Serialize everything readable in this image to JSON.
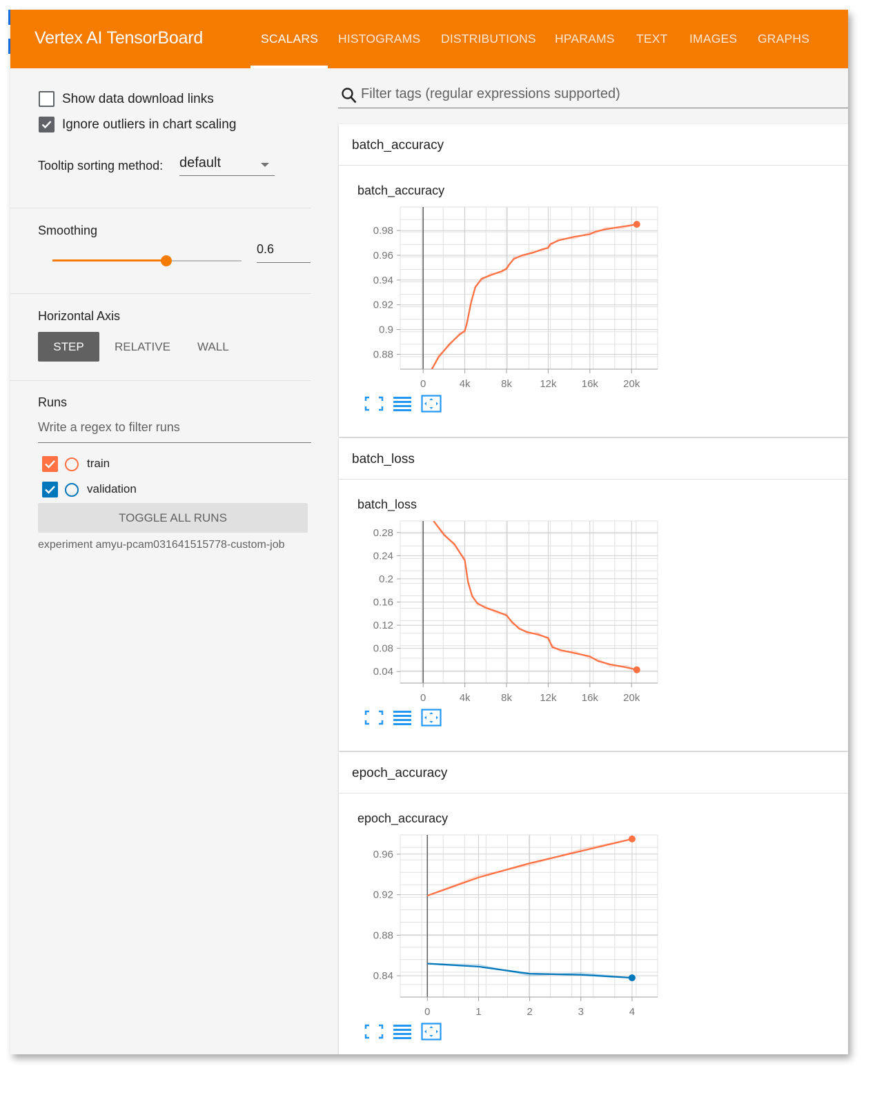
{
  "app": {
    "title": "Vertex AI TensorBoard"
  },
  "tabs": [
    {
      "label": "SCALARS",
      "active": true
    },
    {
      "label": "HISTOGRAMS",
      "active": false
    },
    {
      "label": "DISTRIBUTIONS",
      "active": false
    },
    {
      "label": "HPARAMS",
      "active": false
    },
    {
      "label": "TEXT",
      "active": false
    },
    {
      "label": "IMAGES",
      "active": false
    },
    {
      "label": "GRAPHS",
      "active": false
    }
  ],
  "sidebar": {
    "show_download_links": {
      "label": "Show data download links",
      "checked": false
    },
    "ignore_outliers": {
      "label": "Ignore outliers in chart scaling",
      "checked": true
    },
    "tooltip_sorting": {
      "label": "Tooltip sorting method:",
      "value": "default"
    },
    "smoothing": {
      "label": "Smoothing",
      "value": "0.6",
      "level": 0.6
    },
    "horizontal_axis": {
      "label": "Horizontal Axis",
      "options": [
        "STEP",
        "RELATIVE",
        "WALL"
      ],
      "selected": "STEP"
    },
    "runs": {
      "label": "Runs",
      "filter_placeholder": "Write a regex to filter runs",
      "items": [
        {
          "name": "train",
          "color": "#ff7043",
          "checked": true
        },
        {
          "name": "validation",
          "color": "#0077bb",
          "checked": true
        }
      ],
      "toggle_all_label": "TOGGLE ALL RUNS",
      "experiment": "experiment amyu-pcam031641515778-custom-job"
    }
  },
  "search": {
    "placeholder": "Filter tags (regular expressions supported)"
  },
  "colors": {
    "header": "#f57c00",
    "train": "#ff7043",
    "validation": "#0077bb",
    "icon": "#2196f3"
  },
  "icons": [
    "search-icon",
    "fit-domain-icon",
    "toggle-log-icon",
    "fullscreen-icon"
  ],
  "cards": [
    {
      "title": "batch_accuracy",
      "chart_title": "batch_accuracy"
    },
    {
      "title": "batch_loss",
      "chart_title": "batch_loss"
    },
    {
      "title": "epoch_accuracy",
      "chart_title": "epoch_accuracy"
    }
  ],
  "chart_data": [
    {
      "type": "line",
      "title": "batch_accuracy",
      "x_ticks": [
        "0",
        "4k",
        "8k",
        "12k",
        "16k",
        "20k"
      ],
      "y_ticks": [
        "0.88",
        "0.9",
        "0.92",
        "0.94",
        "0.96",
        "0.98"
      ],
      "xlim": [
        -2200,
        22500
      ],
      "ylim": [
        0.868,
        0.999
      ],
      "grid": true,
      "series": [
        {
          "name": "train",
          "color": "#ff7043",
          "x": [
            700,
            1500,
            2500,
            3500,
            4000,
            4200,
            4600,
            5000,
            5600,
            6500,
            7500,
            8000,
            8200,
            8700,
            9500,
            10500,
            11500,
            12000,
            12200,
            13000,
            14500,
            16000,
            16500,
            17500,
            19000,
            20500
          ],
          "y": [
            0.866,
            0.878,
            0.888,
            0.896,
            0.899,
            0.905,
            0.922,
            0.934,
            0.941,
            0.944,
            0.947,
            0.949,
            0.952,
            0.957,
            0.96,
            0.962,
            0.965,
            0.966,
            0.969,
            0.972,
            0.975,
            0.977,
            0.979,
            0.981,
            0.983,
            0.985
          ]
        }
      ]
    },
    {
      "type": "line",
      "title": "batch_loss",
      "x_ticks": [
        "0",
        "4k",
        "8k",
        "12k",
        "16k",
        "20k"
      ],
      "y_ticks": [
        "0.04",
        "0.08",
        "0.12",
        "0.16",
        "0.2",
        "0.24",
        "0.28"
      ],
      "xlim": [
        -2200,
        22500
      ],
      "ylim": [
        0.02,
        0.3
      ],
      "grid": true,
      "series": [
        {
          "name": "train",
          "color": "#ff7043",
          "x": [
            1000,
            2000,
            3000,
            4000,
            4300,
            4700,
            5200,
            6000,
            7000,
            8000,
            8500,
            9200,
            10000,
            11000,
            12000,
            12400,
            13200,
            14500,
            16000,
            16800,
            18000,
            19500,
            20500
          ],
          "y": [
            0.3,
            0.276,
            0.26,
            0.232,
            0.195,
            0.17,
            0.158,
            0.15,
            0.144,
            0.137,
            0.126,
            0.114,
            0.108,
            0.104,
            0.098,
            0.082,
            0.077,
            0.072,
            0.066,
            0.058,
            0.052,
            0.047,
            0.043
          ]
        }
      ]
    },
    {
      "type": "line",
      "title": "epoch_accuracy",
      "x_ticks": [
        "0",
        "1",
        "2",
        "3",
        "4"
      ],
      "y_ticks": [
        "0.84",
        "0.88",
        "0.92",
        "0.96"
      ],
      "xlim": [
        -0.53,
        4.5
      ],
      "ylim": [
        0.819,
        0.979
      ],
      "grid": true,
      "series": [
        {
          "name": "train",
          "color": "#ff7043",
          "x": [
            0,
            1,
            2,
            3,
            4
          ],
          "y": [
            0.919,
            0.937,
            0.951,
            0.963,
            0.975
          ]
        },
        {
          "name": "validation",
          "color": "#0077bb",
          "x": [
            0,
            1,
            2,
            3,
            4
          ],
          "y": [
            0.852,
            0.849,
            0.842,
            0.841,
            0.838
          ]
        }
      ]
    }
  ]
}
